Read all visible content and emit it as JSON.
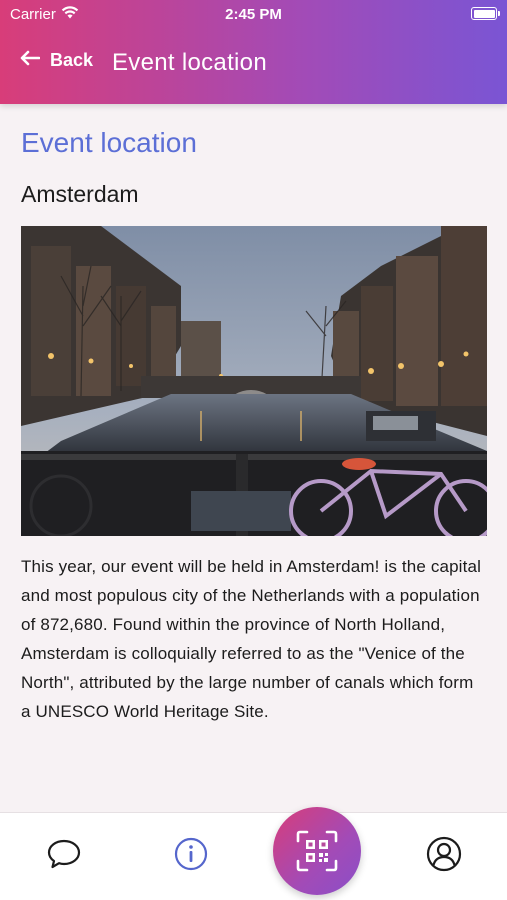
{
  "status_bar": {
    "carrier": "Carrier",
    "time": "2:45 PM"
  },
  "header": {
    "back_label": "Back",
    "title": "Event location"
  },
  "main": {
    "heading": "Event location",
    "city": "Amsterdam",
    "description": "This year, our event will be held in Amsterdam! is the capital and most populous city of the Netherlands with a population of 872,680. Found within the province of North Holland, Amsterdam is colloquially referred to as the \"Venice of the North\", attributed by the large number of canals which form a UNESCO World Heritage Site."
  },
  "tab_bar": {
    "items": [
      {
        "icon": "chat-bubble-icon"
      },
      {
        "icon": "info-icon"
      },
      {
        "icon": "qr-code-icon"
      },
      {
        "icon": "user-icon"
      }
    ]
  },
  "colors": {
    "header_gradient_start": "#d83d79",
    "header_gradient_end": "#7a55d4",
    "heading_accent": "#5c6fd6",
    "info_icon": "#5566cc",
    "background": "#f7f2f4"
  }
}
